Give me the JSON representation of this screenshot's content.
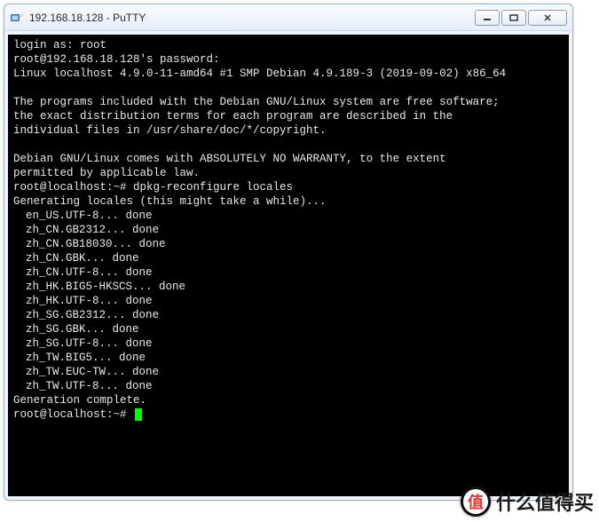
{
  "window": {
    "title": "192.168.18.128 - PuTTY"
  },
  "terminal": {
    "lines": [
      {
        "text": "login as: root"
      },
      {
        "text": "root@192.168.18.128's password:"
      },
      {
        "text": "Linux localhost 4.9.0-11-amd64 #1 SMP Debian 4.9.189-3 (2019-09-02) x86_64"
      },
      {
        "text": ""
      },
      {
        "text": "The programs included with the Debian GNU/Linux system are free software;"
      },
      {
        "text": "the exact distribution terms for each program are described in the"
      },
      {
        "text": "individual files in /usr/share/doc/*/copyright."
      },
      {
        "text": ""
      },
      {
        "text": "Debian GNU/Linux comes with ABSOLUTELY NO WARRANTY, to the extent"
      },
      {
        "text": "permitted by applicable law."
      },
      {
        "text": "root@localhost:~# dpkg-reconfigure locales"
      },
      {
        "text": "Generating locales (this might take a while)..."
      },
      {
        "text": "en_US.UTF-8... done",
        "indent": true
      },
      {
        "text": "zh_CN.GB2312... done",
        "indent": true
      },
      {
        "text": "zh_CN.GB18030... done",
        "indent": true
      },
      {
        "text": "zh_CN.GBK... done",
        "indent": true
      },
      {
        "text": "zh_CN.UTF-8... done",
        "indent": true
      },
      {
        "text": "zh_HK.BIG5-HKSCS... done",
        "indent": true
      },
      {
        "text": "zh_HK.UTF-8... done",
        "indent": true
      },
      {
        "text": "zh_SG.GB2312... done",
        "indent": true
      },
      {
        "text": "zh_SG.GBK... done",
        "indent": true
      },
      {
        "text": "zh_SG.UTF-8... done",
        "indent": true
      },
      {
        "text": "zh_TW.BIG5... done",
        "indent": true
      },
      {
        "text": "zh_TW.EUC-TW... done",
        "indent": true
      },
      {
        "text": "zh_TW.UTF-8... done",
        "indent": true
      },
      {
        "text": "Generation complete."
      }
    ],
    "prompt": "root@localhost:~# "
  },
  "watermark": {
    "badge": "值",
    "text": "什么值得买"
  }
}
